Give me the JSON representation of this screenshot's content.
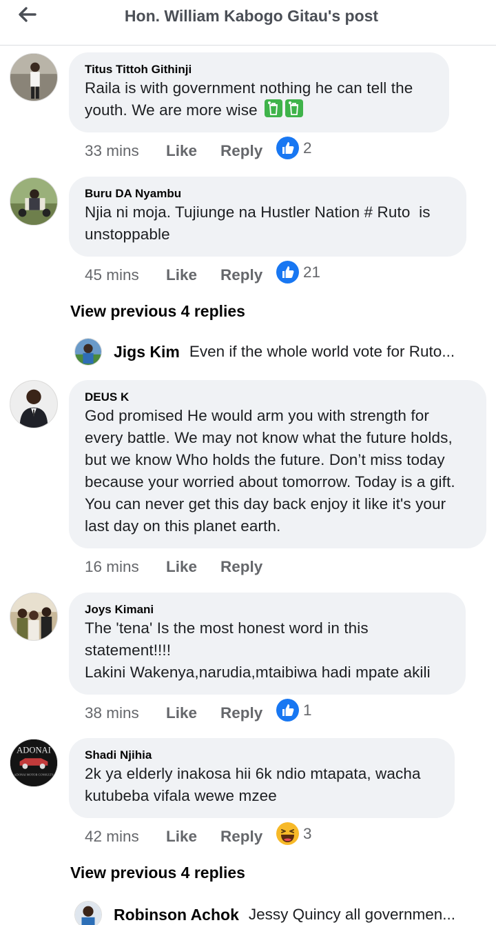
{
  "header": {
    "title": "Hon. William Kabogo Gitau's post"
  },
  "actions": {
    "like_label": "Like",
    "reply_label": "Reply"
  },
  "comments": [
    {
      "author": "Titus Tittoh Githinji",
      "text": "Raila is with government nothing he can tell the youth. We are more wise",
      "time": "33 mins",
      "reaction": "like",
      "reaction_count": "2",
      "emoji": "recycle-bin-emoji"
    },
    {
      "author": "Buru DA Nyambu",
      "text": "Njia ni moja. Tujiunge na Hustler Nation # Ruto  is unstoppable",
      "time": "45 mins",
      "reaction": "like",
      "reaction_count": "21"
    },
    {
      "author": "DEUS K",
      "text": "God promised He would arm you with strength for every battle. We may not know what the future holds, but we know Who holds the future. Don’t miss today because your worried about tomorrow. Today is a gift. You can never get this day back enjoy it like it's your last day on this planet earth.",
      "time": "16 mins"
    },
    {
      "author": "Joys Kimani",
      "text": "The 'tena' Is the most honest word in this statement!!!!\nLakini Wakenya,narudia,mtaibiwa hadi mpate akili",
      "time": "38 mins",
      "reaction": "like",
      "reaction_count": "1"
    },
    {
      "author": "Shadi Njihia",
      "text": "2k ya elderly inakosa hii 6k ndio mtapata, wacha kutubeba vifala wewe mzee",
      "time": "42 mins",
      "reaction": "haha",
      "reaction_count": "3",
      "avatar_logo": "ADONAI",
      "avatar_sub": "ADONAI MOTOR CONSULTS"
    }
  ],
  "replies": [
    {
      "view_previous": "View previous 4 replies",
      "author": "Jigs Kim",
      "text": "Even if the whole world vote for Ruto..."
    },
    {
      "view_previous": "View previous 4 replies",
      "author": "Robinson Achok",
      "text": "Jessy Quincy  all governmen..."
    }
  ],
  "colors": {
    "like_blue": "#1877f2",
    "bubble_bg": "#f0f2f5",
    "meta_grey": "#65676b",
    "haha_yellow": "#f7b928"
  }
}
